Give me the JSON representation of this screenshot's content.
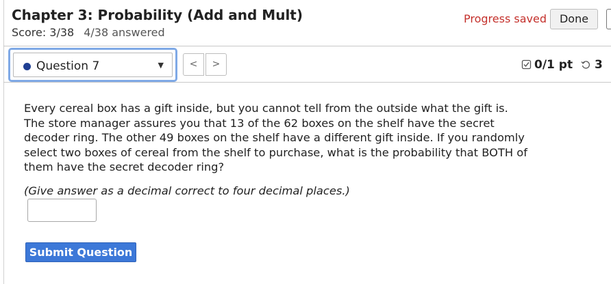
{
  "header": {
    "title": "Chapter 3: Probability (Add and Mult)",
    "score": "Score: 3/38",
    "answered": "4/38 answered",
    "progress_status": "Progress saved",
    "done_label": "Done"
  },
  "question_nav": {
    "current_question": "Question 7",
    "prev_label": "<",
    "next_label": ">",
    "points": "0/1 pt",
    "attempts": "3"
  },
  "question": {
    "text": "Every cereal box has a gift inside, but you cannot tell from the outside what the gift is. The store manager assures you that 13 of the 62 boxes on the shelf have the secret decoder ring. The other 49 boxes on the shelf have a different gift inside. If you randomly select two boxes of cereal from the shelf to purchase, what is the probability that BOTH of them have the secret decoder ring?",
    "instruction": "(Give answer as a decimal correct to four decimal places.)",
    "answer_value": "",
    "submit_label": "Submit Question"
  },
  "colors": {
    "progress_saved": "#c4302b",
    "submit_button": "#3c78d8",
    "question_dot": "#1f3f93",
    "focus_ring": "#7fa9e6"
  }
}
